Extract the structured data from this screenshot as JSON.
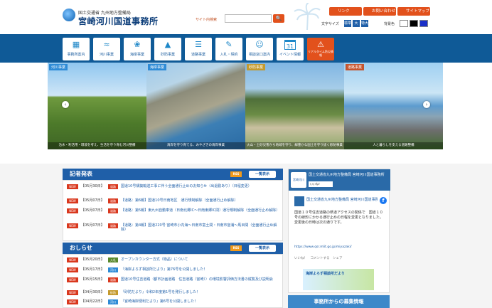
{
  "header": {
    "ministry": "国土交通省 九州地方整備局",
    "office": "宮崎河川国道事務所",
    "search_label": "サイト内検索",
    "search_placeholder": "",
    "search_icon": "search-icon",
    "buttons": [
      "リンク",
      "お問い合わせ",
      "サイトマップ"
    ],
    "fontsize_label": "文字サイズ",
    "fontsizes": [
      "標準",
      "大",
      "特大"
    ],
    "color_label": "背景色"
  },
  "nav": [
    {
      "label": "事務所案内",
      "icon": "building-icon"
    },
    {
      "label": "河川事業",
      "icon": "river-icon"
    },
    {
      "label": "海岸事業",
      "icon": "palm-icon"
    },
    {
      "label": "砂防事業",
      "icon": "mountain-icon"
    },
    {
      "label": "道路事業",
      "icon": "road-icon"
    },
    {
      "label": "入札・契約",
      "icon": "document-icon"
    },
    {
      "label": "相談窓口案内",
      "icon": "people-icon"
    },
    {
      "label": "イベント情報",
      "icon": "calendar-icon",
      "badge": "31"
    },
    {
      "label": "リアルタイム防災情報",
      "icon": "alert-icon"
    }
  ],
  "banner": [
    {
      "tag": "河川事業",
      "caption": "治水・利活用・環境を考え、生活を守り育む河川整備"
    },
    {
      "tag": "海岸事業",
      "caption": "海岸を守り育てる、みやざきの海岸事業"
    },
    {
      "tag": "砂防事業",
      "caption": "火山・土砂災害から地域を守り、緑豊かな国土を守り抜く砂防事業"
    },
    {
      "tag": "道路事業",
      "caption": "人と暮らしを支える道路整備"
    }
  ],
  "press": {
    "title": "記者発表",
    "rss": "RSS",
    "list_button": "一覧表示",
    "rows": [
      {
        "new": "NEW",
        "date": "【05月30日】",
        "cat": "道路",
        "text": "国道10号構築輸送工事に伴う全面通行止めのお知らせ（出退勤あり）（日程変更）"
      },
      {
        "new": "NEW",
        "date": "【05月07日】",
        "cat": "道路",
        "text": "【道路：第6報】国道10号日南地区　通行規制解除（全面通行止め解除）"
      },
      {
        "new": "NEW",
        "date": "【05月07日】",
        "cat": "道路",
        "text": "【道路：第5報】東九州自動車道（日南北郷IC～日南東郷IC間）通行規制解除（全面通行止め解除）"
      },
      {
        "new": "NEW",
        "date": "【05月07日】",
        "cat": "道路",
        "text": "【道路：第4報】国道220号 宮崎市小内海～日南市富土間・日南市宮浦～馬目間（全面通行止め解除）"
      }
    ]
  },
  "notice": {
    "title": "おしらせ",
    "rss": "RSS",
    "list_button": "一覧表示",
    "rows": [
      {
        "new": "NEW",
        "date": "【05月20日】",
        "cat": "入札",
        "text": "オープンカウンター方式（物品）について"
      },
      {
        "new": "NEW",
        "date": "【05月17日】",
        "cat": "河川",
        "text": "『海岸よろず相談所だより』第76号を公開しました！"
      },
      {
        "new": "NEW",
        "date": "【05月15日】",
        "cat": "道路",
        "text": "国道10号住吉道路（都市計画道路　住吉道路（宮崎））の環境影響評価方法書の縦覧及び説明会"
      },
      {
        "new": "NEW",
        "date": "【04月30日】",
        "cat": "砂防",
        "text": "『砂防だより』令和2年度第1号を発行しました！"
      },
      {
        "new": "NEW",
        "date": "【04月22日】",
        "cat": "河川",
        "text": "『宮崎海岸便利だより』第6号を公開しました！"
      }
    ]
  },
  "facebook": {
    "logo": "宮崎河川",
    "page_name": "国土交通省九州地方整備局 宮崎河川国道事務所",
    "like": "いいね！",
    "post_name": "国土交通省九州地方整備局 宮崎河川国道事務所",
    "post_time": "",
    "body": "国道１０号住吉道路の県道アクセスの関係で　国道１０号の線形にかかる通行止めの日程を変更となりました。変更後の日時は次の通りです。",
    "link": "https://www.qsr.mlit.go.jp/miyazaki/",
    "actions": "いいね！　コメントする　シェア",
    "ad": "海岸よろず相談所だより"
  },
  "recruit": "事務所からの募集情報",
  "colors": {
    "nav": "#0f5a97",
    "accent": "#e2511c",
    "blue": "#1f5fa8"
  }
}
